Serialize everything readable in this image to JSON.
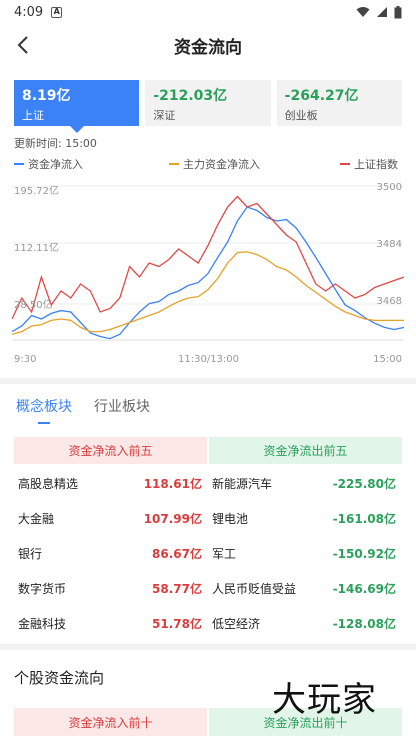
{
  "status": {
    "time": "4:09"
  },
  "nav": {
    "title": "资金流向"
  },
  "cards": [
    {
      "value": "8.19亿",
      "name": "上证"
    },
    {
      "value": "-212.03亿",
      "name": "深证"
    },
    {
      "value": "-264.27亿",
      "name": "创业板"
    }
  ],
  "update_time": "更新时间: 15:00",
  "legend": {
    "net_inflow": "资金净流入",
    "main_inflow": "主力资金净流入",
    "sh_index": "上证指数"
  },
  "chart_labels": {
    "y_left_top": "195.72亿",
    "y_left_mid": "112.11亿",
    "y_left_bottom": "28.50亿",
    "y_right_top": "3500",
    "y_right_mid": "3484",
    "y_right_bottom": "3468",
    "x_start": "9:30",
    "x_mid": "11:30/13:00",
    "x_end": "15:00"
  },
  "chart_data": {
    "type": "line",
    "x_labels": [
      "9:30",
      "11:30/13:00",
      "15:00"
    ],
    "y_left_ticks": [
      "195.72亿",
      "112.11亿",
      "28.50亿"
    ],
    "y_right_ticks": [
      "3500",
      "3484",
      "3468"
    ],
    "ylim_left": [
      0,
      220
    ],
    "ylim_right": [
      3458,
      3502
    ],
    "colors": {
      "net_inflow": "#3b82f6",
      "main_inflow": "#e6a12a",
      "sh_index": "#e04848"
    },
    "series": [
      {
        "name": "资金净流入",
        "axis": "left",
        "values": [
          12,
          20,
          35,
          30,
          38,
          42,
          40,
          25,
          10,
          5,
          2,
          8,
          25,
          40,
          52,
          55,
          65,
          70,
          78,
          82,
          95,
          118,
          140,
          170,
          190,
          185,
          175,
          170,
          172,
          160,
          140,
          118,
          95,
          72,
          50,
          42,
          32,
          24,
          18,
          15,
          18
        ]
      },
      {
        "name": "主力资金净流入",
        "axis": "left",
        "values": [
          8,
          12,
          20,
          22,
          28,
          30,
          28,
          18,
          12,
          12,
          15,
          20,
          25,
          30,
          35,
          40,
          48,
          55,
          60,
          62,
          72,
          88,
          110,
          125,
          126,
          122,
          115,
          105,
          100,
          90,
          78,
          68,
          58,
          48,
          40,
          35,
          30,
          28,
          28,
          28,
          28
        ]
      },
      {
        "name": "上证指数",
        "axis": "right",
        "values": [
          3464,
          3470,
          3466,
          3476,
          3468,
          3472,
          3470,
          3474,
          3472,
          3466,
          3467,
          3470,
          3479,
          3476,
          3480,
          3479,
          3481,
          3484,
          3482,
          3480,
          3485,
          3491,
          3496,
          3499,
          3496,
          3497,
          3494,
          3491,
          3488,
          3486,
          3480,
          3474,
          3472,
          3474,
          3472,
          3470,
          3471,
          3473,
          3474,
          3475,
          3476
        ]
      }
    ]
  },
  "tabs": [
    "概念板块",
    "行业板块"
  ],
  "table": {
    "in_header": "资金净流入前五",
    "out_header": "资金净流出前五",
    "rows": [
      {
        "in_name": "高股息精选",
        "in_value": "118.61亿",
        "out_name": "新能源汽车",
        "out_value": "-225.80亿"
      },
      {
        "in_name": "大金融",
        "in_value": "107.99亿",
        "out_name": "锂电池",
        "out_value": "-161.08亿"
      },
      {
        "in_name": "银行",
        "in_value": "86.67亿",
        "out_name": "军工",
        "out_value": "-150.92亿"
      },
      {
        "in_name": "数字货币",
        "in_value": "58.77亿",
        "out_name": "人民币贬值受益",
        "out_value": "-146.69亿"
      },
      {
        "in_name": "金融科技",
        "in_value": "51.78亿",
        "out_name": "低空经济",
        "out_value": "-128.08亿"
      }
    ]
  },
  "stock_section": {
    "title": "个股资金流向",
    "in_header": "资金净流入前十",
    "out_header": "资金净流出前十"
  },
  "watermark": "大玩家"
}
